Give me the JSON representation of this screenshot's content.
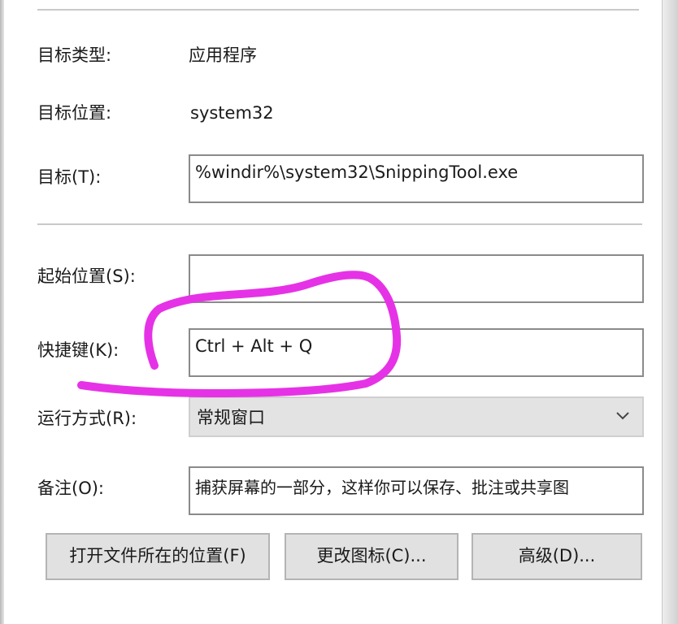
{
  "window": {
    "panel": "shortcut-properties"
  },
  "target_type": {
    "label": "目标类型:",
    "value": "应用程序"
  },
  "target_location": {
    "label": "目标位置:",
    "value": "system32"
  },
  "target": {
    "label": "目标(T):",
    "value": "%windir%\\system32\\SnippingTool.exe"
  },
  "start_in": {
    "label": "起始位置(S):",
    "value": ""
  },
  "shortcut_key": {
    "label": "快捷键(K):",
    "value": "Ctrl + Alt + Q"
  },
  "run": {
    "label": "运行方式(R):",
    "selected": "常规窗口"
  },
  "comment": {
    "label": "备注(O):",
    "value": "捕获屏幕的一部分，这样你可以保存、批注或共享图"
  },
  "buttons": {
    "open_location": "打开文件所在的位置(F)",
    "change_icon": "更改图标(C)...",
    "advanced": "高级(D)..."
  },
  "icons": {
    "run_dropdown": "chevron-down-icon"
  },
  "colors": {
    "annotation": "#e632e6",
    "field_border": "#8a8a8a",
    "button_bg": "#e1e1e1",
    "dropdown_bg": "#e3e3e3"
  }
}
